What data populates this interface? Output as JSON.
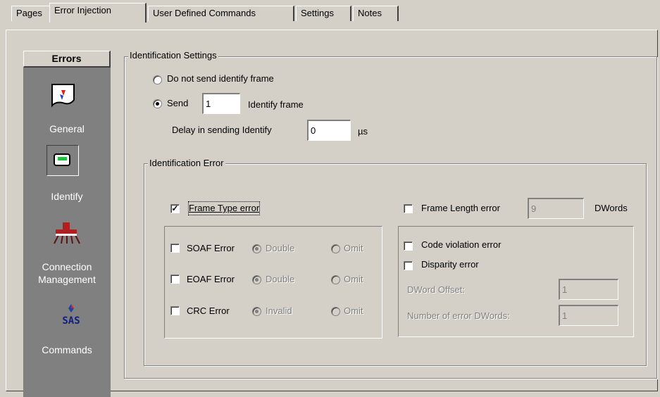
{
  "tabs": [
    "Pages",
    "Error Injection",
    "User Defined Commands",
    "Settings",
    "Notes"
  ],
  "sidebar": {
    "header": "Errors",
    "items": [
      {
        "label": "General",
        "icon": "general-icon"
      },
      {
        "label": "Identify",
        "icon": "identify-icon"
      },
      {
        "label": "Connection\nManagement",
        "icon": "connection-management-icon"
      },
      {
        "label": "Commands",
        "icon": "sas-commands-icon",
        "icon_text": "SAS"
      }
    ]
  },
  "identification_settings": {
    "title": "Identification Settings",
    "no_send_label": "Do not send identify frame",
    "send_label": "Send",
    "send_count": "1",
    "identify_frame_label": "Identify frame",
    "delay_label": "Delay in sending Identify",
    "delay_value": "0",
    "delay_unit": "µs",
    "selected": "send"
  },
  "identification_error": {
    "title": "Identification Error",
    "frame_type_error": {
      "label": "Frame Type error",
      "checked": true
    },
    "frame_length_error": {
      "label": "Frame Length error",
      "value": "9",
      "unit": "DWords",
      "checked": false
    },
    "soaf": {
      "label": "SOAF Error",
      "opt1": "Double",
      "opt2": "Omit"
    },
    "eoaf": {
      "label": "EOAF Error",
      "opt1": "Double",
      "opt2": "Omit"
    },
    "crc": {
      "label": "CRC Error",
      "opt1": "Invalid",
      "opt2": "Omit"
    },
    "code_violation": {
      "label": "Code violation error"
    },
    "disparity": {
      "label": "Disparity error"
    },
    "dword_offset": {
      "label": "DWord Offset:",
      "value": "1"
    },
    "num_error_dwords": {
      "label": "Number of error DWords:",
      "value": "1"
    }
  },
  "colors": {
    "face": "#d4d0c8",
    "sidebar": "#808080",
    "shadow": "#404040",
    "highlight": "#ffffff",
    "accent": "#0000cc"
  }
}
